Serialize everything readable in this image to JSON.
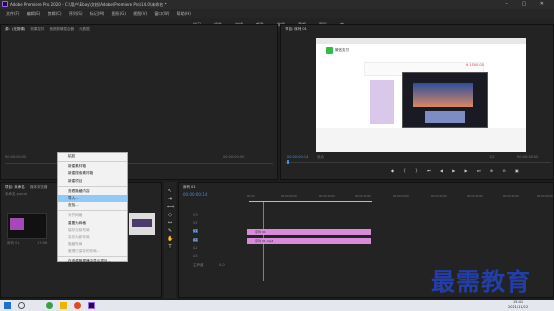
{
  "titlebar": {
    "text": "Adobe Premiere Pro 2020 - C:\\用户\\Ebay\\文档\\Adobe\\Premiere Pro\\14.0\\未命名 *",
    "controls": "– ▢ ✕"
  },
  "menu": [
    "文件(F)",
    "编辑(E)",
    "剪辑(C)",
    "序列(S)",
    "标记(M)",
    "图形(G)",
    "视图(V)",
    "窗口(W)",
    "帮助(H)"
  ],
  "workspaces": [
    "学习",
    "组件",
    "编辑",
    "颜色",
    "效果",
    "音频",
    "图形",
    "库"
  ],
  "source": {
    "tabs": [
      "源：(无剪辑)",
      "效果控件",
      "音频剪辑混合器",
      "元数据"
    ],
    "timecode": "00:00:00:00",
    "page": "第1页"
  },
  "program": {
    "tab": "节目: 序列 01",
    "timecode": "00:00:00:14",
    "fit": "适合",
    "full": "1/2",
    "duration": "00:00:18:00"
  },
  "project": {
    "tabs": [
      "项目: 未命名",
      "媒体浏览器"
    ],
    "file": "未命名.prproj",
    "item": "序列 01",
    "item_dur": "17:06"
  },
  "context_menu": {
    "items": [
      "粘贴",
      "新建素材箱",
      "新建搜索素材箱",
      "新建项目",
      "查看隐藏内容",
      "导入...",
      "查找...",
      "对齐网格",
      "重置为网格",
      "保存当前布局",
      "另存为新布局",
      "隐藏布局",
      "管理已保存的布局...",
      "在资源管理器中显示项目..."
    ],
    "highlighted": "导入..."
  },
  "timeline": {
    "tab": "序列 01",
    "timecode": "00:00:00:14",
    "tracks": [
      "V3",
      "V2",
      "V1",
      "A1",
      "A2",
      "A3"
    ],
    "master": "主声道",
    "master_val": "0.0",
    "ruler": [
      "00:00",
      "00:00:05:00",
      "00:00:10:00",
      "00:00:15:00",
      "00:00:20:00",
      "00:00:25:00",
      "00:00:30:00",
      "00:00:35:00",
      "00:00:40:00"
    ],
    "clip_v": "序列 01",
    "clip_a": "序列 01.mp4"
  },
  "browser": {
    "wechat": "微信支付",
    "pay": "¥ 1500.00"
  },
  "taskbar": {
    "time": "15:41",
    "date": "2021/11/12"
  },
  "watermark": "最需教育"
}
